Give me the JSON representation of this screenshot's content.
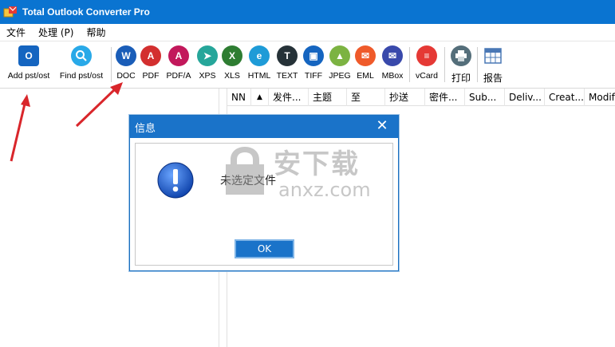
{
  "window": {
    "title": "Total Outlook Converter Pro"
  },
  "menu": {
    "items": [
      "文件",
      "处理 (P)",
      "帮助"
    ]
  },
  "toolbar": {
    "items": [
      {
        "label": "Add pst/ost",
        "icon": "outlook-add-icon",
        "color": "#1565c0"
      },
      {
        "label": "Find pst/ost",
        "icon": "search-icon",
        "color": "#29a9e8"
      },
      {
        "label": "DOC",
        "icon": "word-icon",
        "color": "#1a5db8"
      },
      {
        "label": "PDF",
        "icon": "pdf-icon",
        "color": "#d32f2f"
      },
      {
        "label": "PDF/A",
        "icon": "pdfa-icon",
        "color": "#c2185b"
      },
      {
        "label": "XPS",
        "icon": "xps-icon",
        "color": "#26a69a"
      },
      {
        "label": "XLS",
        "icon": "excel-icon",
        "color": "#2e7d32"
      },
      {
        "label": "HTML",
        "icon": "html-icon",
        "color": "#1e9bd7"
      },
      {
        "label": "TEXT",
        "icon": "text-icon",
        "color": "#263238"
      },
      {
        "label": "TIFF",
        "icon": "tiff-icon",
        "color": "#1565c0"
      },
      {
        "label": "JPEG",
        "icon": "jpeg-icon",
        "color": "#7cb342"
      },
      {
        "label": "EML",
        "icon": "eml-icon",
        "color": "#ef5a2a"
      },
      {
        "label": "MBox",
        "icon": "mbox-icon",
        "color": "#3949ab"
      },
      {
        "label": "vCard",
        "icon": "vcard-icon",
        "color": "#e53935"
      },
      {
        "label": "打印",
        "icon": "printer-icon",
        "color": "#546e7a"
      },
      {
        "label": "报告",
        "icon": "report-grid-icon",
        "color": "#4a78b5"
      }
    ]
  },
  "columns": [
    "NN",
    "▲",
    "发件...",
    "主题",
    "至",
    "抄送",
    "密件...",
    "Sub...",
    "Deliv...",
    "Creat...",
    "Modif"
  ],
  "dialog": {
    "title": "信息",
    "message": "未选定文件",
    "ok_label": "OK"
  },
  "watermark": {
    "text": "安下载",
    "sub": "anxz.com"
  }
}
